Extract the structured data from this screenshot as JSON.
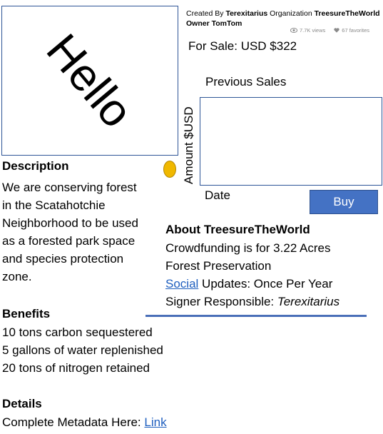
{
  "image": {
    "word": "Hello"
  },
  "meta": {
    "created_by_prefix": "Created By ",
    "creator": "Terexitarius",
    "org_prefix": " Organization ",
    "org": "TreesureTheWorld",
    "owner_prefix": "Owner ",
    "owner": "TomTom",
    "views": "7.7K views",
    "favorites": "67 favorites"
  },
  "sale": {
    "text": "For Sale: USD $322"
  },
  "chart": {
    "title": "Previous Sales",
    "ylabel": "Amount $USD",
    "xlabel": "Date"
  },
  "buy": {
    "label": "Buy"
  },
  "description": {
    "heading": "Description",
    "lines": [
      "We are conserving forest",
      "in the Scatahotchie",
      "Neighborhood to be used",
      "as a forested park space",
      "and species protection",
      "zone."
    ]
  },
  "about": {
    "heading": "About TreesureTheWorld",
    "line1": "Crowdfunding is for 3.22 Acres",
    "line2": "Forest Preservation",
    "social_link": "Social",
    "social_rest": " Updates: Once Per Year",
    "signer_prefix": "Signer Responsible: ",
    "signer": "Terexitarius"
  },
  "benefits": {
    "heading": "Benefits",
    "items": [
      "10 tons carbon sequestered",
      "5 gallons of water replenished",
      "20 tons of nitrogen retained"
    ]
  },
  "details": {
    "heading": "Details",
    "prefix": "Complete Metadata Here: ",
    "link": "Link"
  },
  "colors": {
    "accent": "#4472c4",
    "link": "#1f5fbf",
    "border": "#2e5597",
    "coin": "#f0b800"
  }
}
